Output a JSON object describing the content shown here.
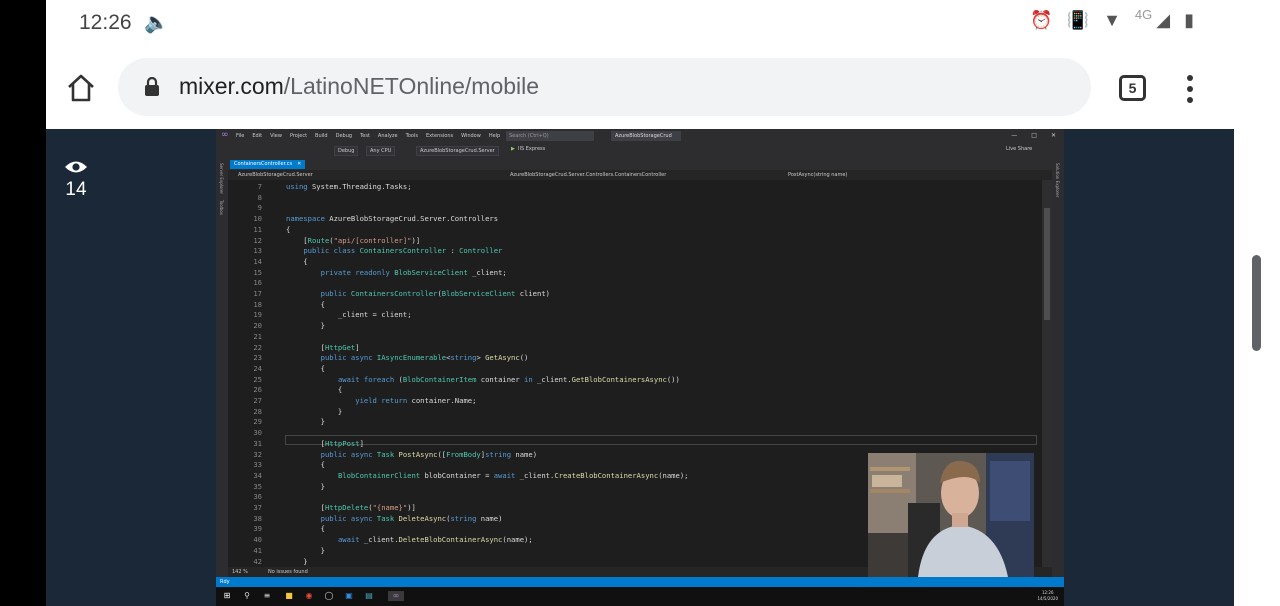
{
  "status_bar": {
    "time": "12:26",
    "network": "4G"
  },
  "browser": {
    "url_host": "mixer.com",
    "url_path": "/LatinoNETOnline/mobile",
    "tab_count": "5"
  },
  "stream": {
    "viewer_count": "14"
  },
  "vs": {
    "menu_items": [
      "File",
      "Edit",
      "View",
      "Project",
      "Build",
      "Debug",
      "Test",
      "Analyze",
      "Tools",
      "Extensions",
      "Window",
      "Help"
    ],
    "search_placeholder": "Search (Ctrl+Q)",
    "solution_name": "AzureBlobStorageCrud",
    "toolbar": {
      "config": "Debug",
      "platform": "Any CPU",
      "startup_project": "AzureBlobStorageCrud.Server",
      "run_target": "IIS Express",
      "live_share": "Live Share"
    },
    "doc_tab": "ContainersController.cs",
    "nav": {
      "project": "AzureBlobStorageCrud.Server",
      "class": "AzureBlobStorageCrud.Server.Controllers.ContainersController",
      "member": "PostAsync(string name)"
    },
    "side_tools_left": [
      "Server Explorer",
      "Toolbox"
    ],
    "side_tools_right": [
      "Solution Explorer"
    ],
    "code_lines": [
      {
        "n": "7",
        "t": "using System.Threading.Tasks;"
      },
      {
        "n": "8",
        "t": ""
      },
      {
        "n": "9",
        "t": ""
      },
      {
        "n": "10",
        "t": "namespace AzureBlobStorageCrud.Server.Controllers"
      },
      {
        "n": "11",
        "t": "{"
      },
      {
        "n": "12",
        "t": "    [Route(\"api/[controller]\")]"
      },
      {
        "n": "13",
        "t": "    public class ContainersController : Controller"
      },
      {
        "n": "14",
        "t": "    {"
      },
      {
        "n": "15",
        "t": "        private readonly BlobServiceClient _client;"
      },
      {
        "n": "16",
        "t": ""
      },
      {
        "n": "17",
        "t": "        public ContainersController(BlobServiceClient client)"
      },
      {
        "n": "18",
        "t": "        {"
      },
      {
        "n": "19",
        "t": "            _client = client;"
      },
      {
        "n": "20",
        "t": "        }"
      },
      {
        "n": "21",
        "t": ""
      },
      {
        "n": "22",
        "t": "        [HttpGet]"
      },
      {
        "n": "23",
        "t": "        public async IAsyncEnumerable<string> GetAsync()"
      },
      {
        "n": "24",
        "t": "        {"
      },
      {
        "n": "25",
        "t": "            await foreach (BlobContainerItem container in _client.GetBlobContainersAsync())"
      },
      {
        "n": "26",
        "t": "            {"
      },
      {
        "n": "27",
        "t": "                yield return container.Name;"
      },
      {
        "n": "28",
        "t": "            }"
      },
      {
        "n": "29",
        "t": "        }"
      },
      {
        "n": "30",
        "t": ""
      },
      {
        "n": "31",
        "t": "        [HttpPost]"
      },
      {
        "n": "32",
        "t": "        public async Task PostAsync([FromBody]string name)"
      },
      {
        "n": "33",
        "t": "        {"
      },
      {
        "n": "34",
        "t": "            BlobContainerClient blobContainer = await _client.CreateBlobContainerAsync(name);"
      },
      {
        "n": "35",
        "t": "        }"
      },
      {
        "n": "36",
        "t": ""
      },
      {
        "n": "37",
        "t": "        [HttpDelete(\"{name}\")]"
      },
      {
        "n": "38",
        "t": "        public async Task DeleteAsync(string name)"
      },
      {
        "n": "39",
        "t": "        {"
      },
      {
        "n": "40",
        "t": "            await _client.DeleteBlobContainerAsync(name);"
      },
      {
        "n": "41",
        "t": "        }"
      },
      {
        "n": "42",
        "t": "    }"
      }
    ],
    "zoom": "142 %",
    "issues": "No issues found",
    "status_left": "Rdy",
    "clock": "12:26",
    "date": "14/5/2020"
  },
  "colors": {
    "mixer_bg": "#1b2838",
    "vs_accent": "#007acc",
    "vs_editor": "#1e1e1e"
  }
}
